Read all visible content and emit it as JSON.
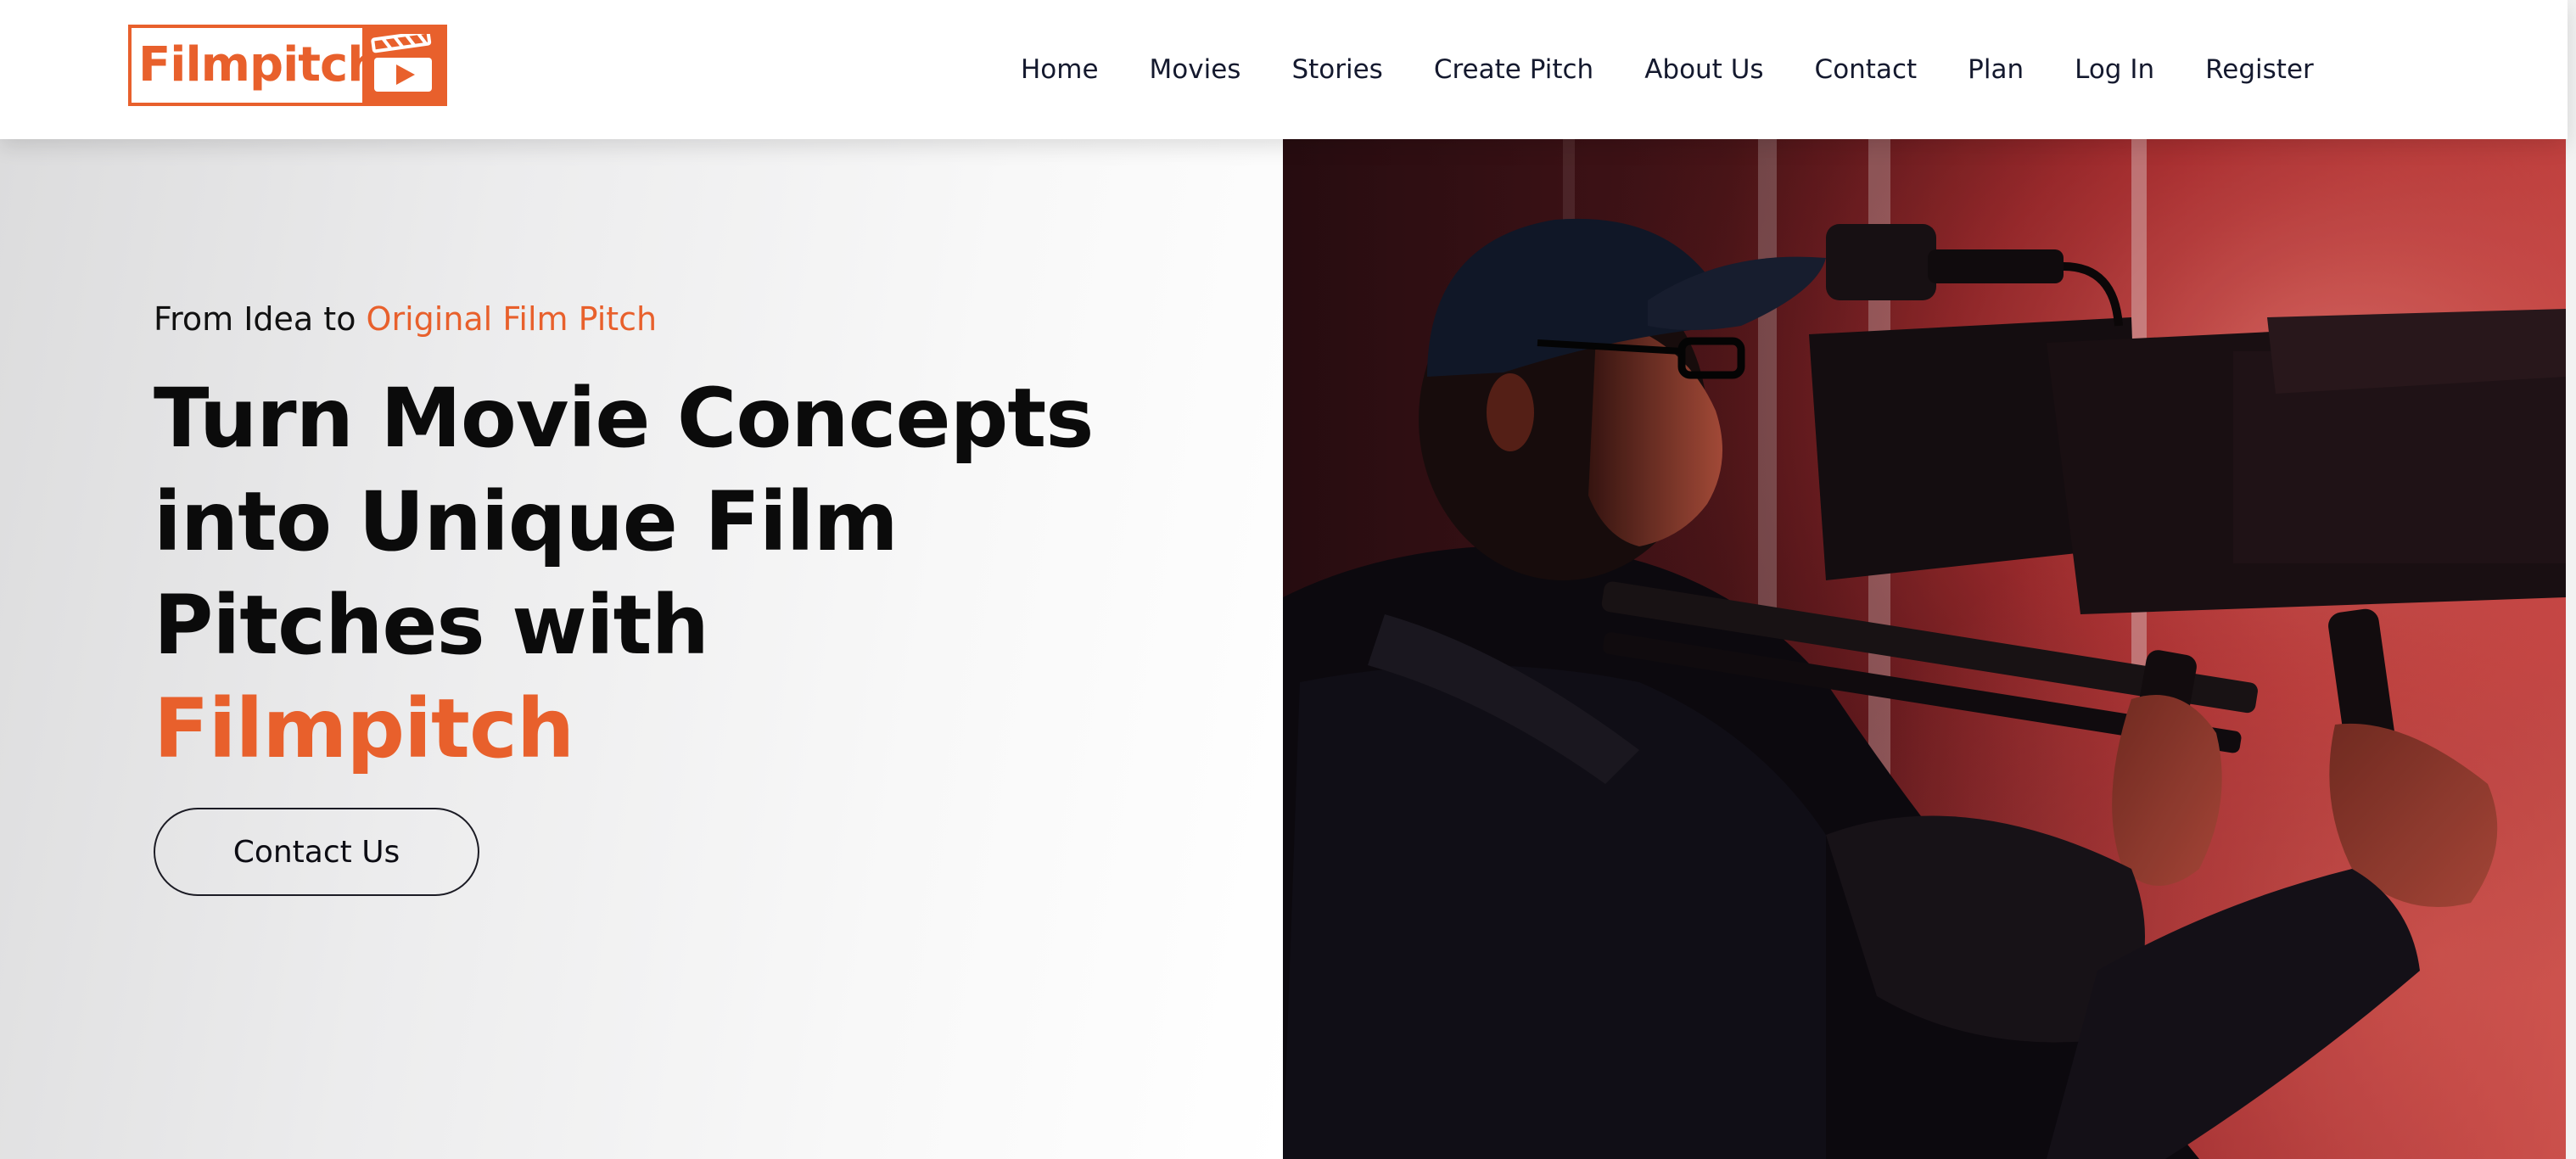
{
  "brand": {
    "name": "Filmpitch",
    "logo_icon": "clapperboard-play-icon",
    "accent_color": "#e8602c"
  },
  "nav": {
    "items": [
      {
        "label": "Home"
      },
      {
        "label": "Movies"
      },
      {
        "label": "Stories"
      },
      {
        "label": "Create Pitch"
      },
      {
        "label": "About Us"
      },
      {
        "label": "Contact"
      },
      {
        "label": "Plan"
      },
      {
        "label": "Log In"
      },
      {
        "label": "Register"
      }
    ]
  },
  "hero": {
    "eyebrow_prefix": "From Idea to",
    "eyebrow_accent": "Original Film Pitch",
    "headline_lines": [
      "Turn Movie Concepts",
      "into Unique Film",
      "Pitches with"
    ],
    "headline_brand": "Filmpitch",
    "cta_label": "Contact Us",
    "image_subject": "camera-operator-photo"
  }
}
